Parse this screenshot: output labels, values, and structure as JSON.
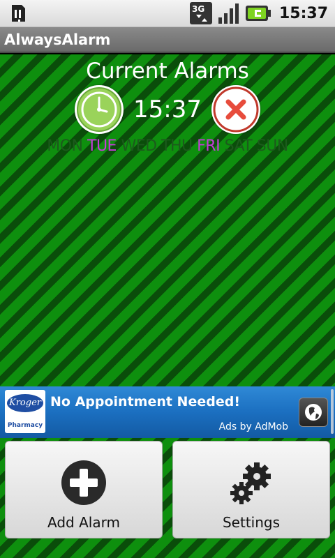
{
  "status_bar": {
    "time": "15:37",
    "network": "3G"
  },
  "app": {
    "title": "AlwaysAlarm"
  },
  "alarms": {
    "heading": "Current Alarms",
    "items": [
      {
        "time": "15:37",
        "days": [
          {
            "label": "MON",
            "active": false
          },
          {
            "label": "TUE",
            "active": true
          },
          {
            "label": "WED",
            "active": false
          },
          {
            "label": "THU",
            "active": false
          },
          {
            "label": "FRI",
            "active": true
          },
          {
            "label": "SAT",
            "active": false
          },
          {
            "label": "SUN",
            "active": false
          }
        ]
      }
    ]
  },
  "ad": {
    "logo_text": "Kroger",
    "logo_subtext": "Pharmacy",
    "title": "No Appointment Needed!",
    "by": "Ads by AdMob"
  },
  "buttons": {
    "add_label": "Add Alarm",
    "settings_label": "Settings"
  },
  "colors": {
    "active_day": "#c43cd8",
    "inactive_day": "#1c5a1c",
    "stripe_light": "#0e8f0e",
    "stripe_dark": "#0a4d0a"
  }
}
